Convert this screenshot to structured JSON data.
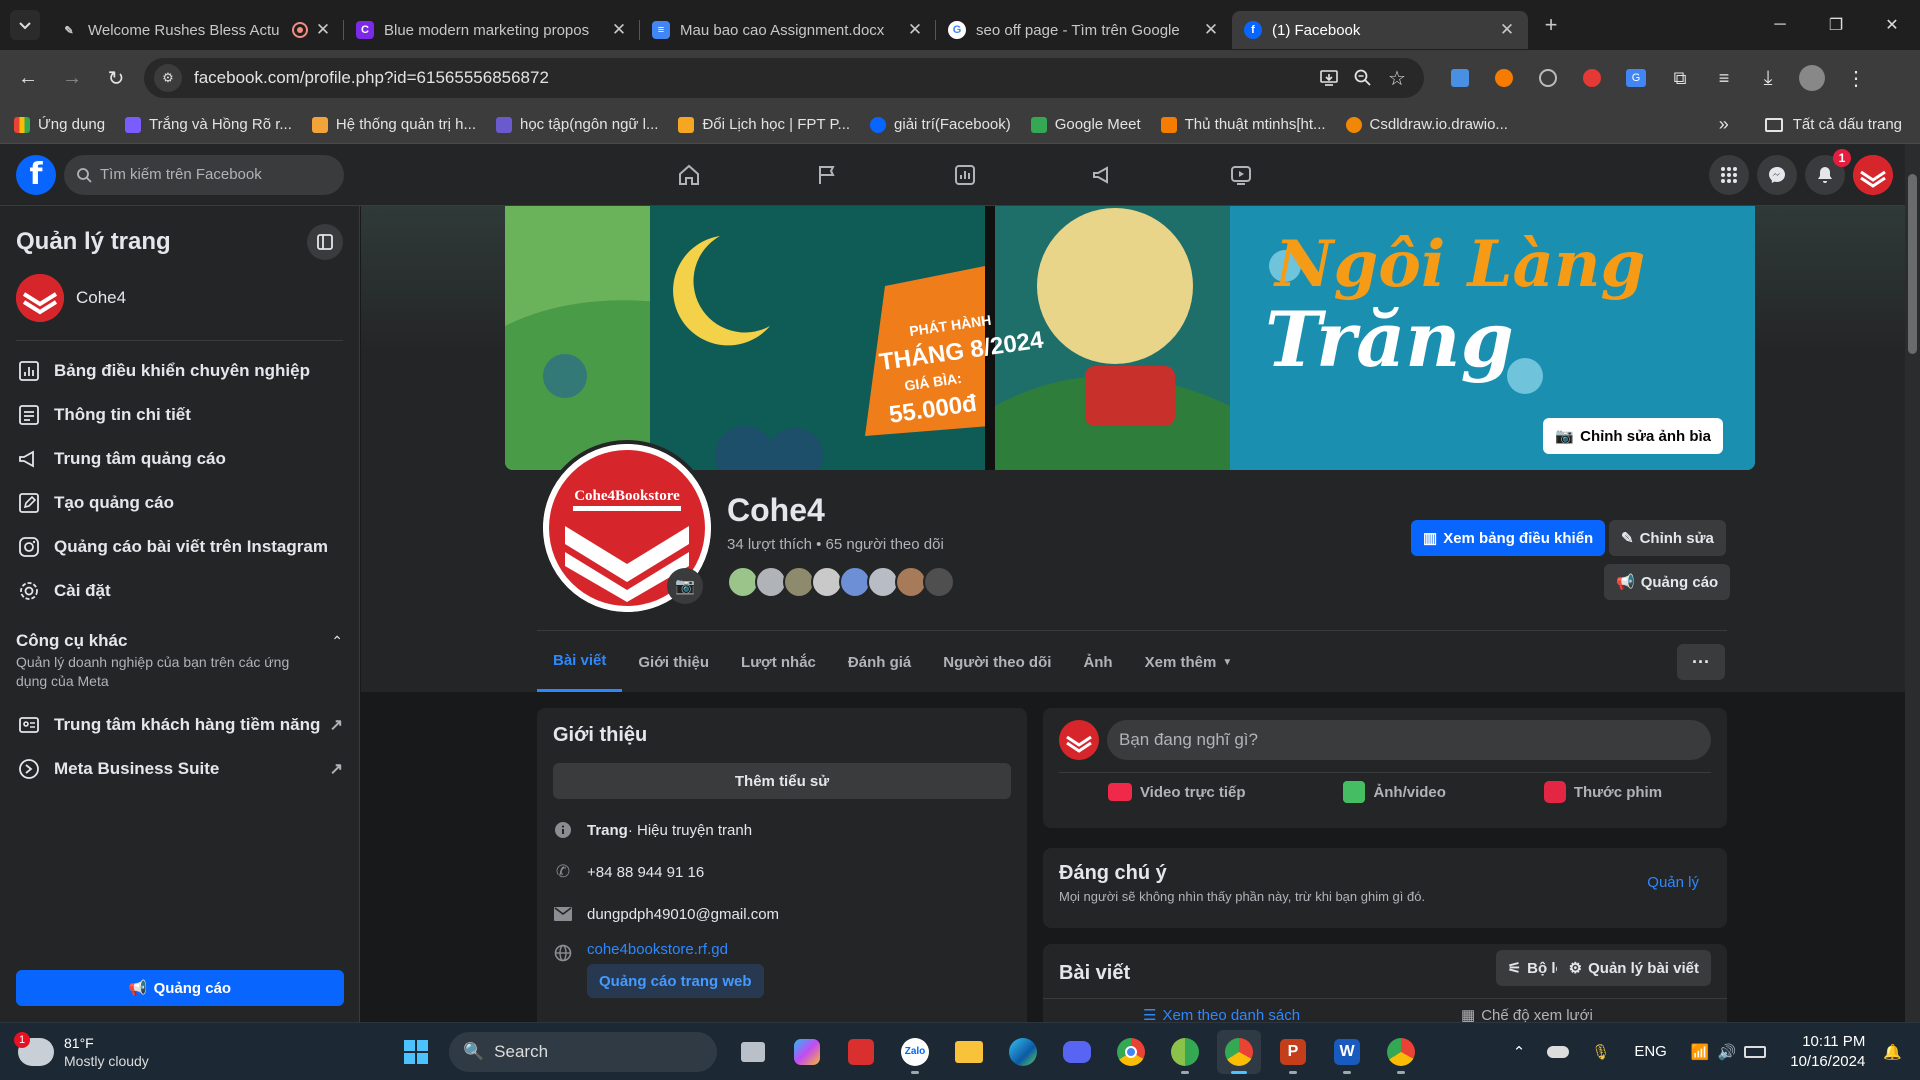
{
  "browser": {
    "tabs": [
      {
        "title": "Welcome Rushes Bless Actu",
        "icon": "feather-icon",
        "active": false
      },
      {
        "title": "Blue modern marketing propos",
        "icon": "canva-icon",
        "active": false
      },
      {
        "title": "Mau bao cao Assignment.docx",
        "icon": "docs-icon",
        "active": false
      },
      {
        "title": "seo off page - Tìm trên Google",
        "icon": "google-icon",
        "active": false
      },
      {
        "title": "(1) Facebook",
        "icon": "facebook-icon",
        "active": true
      }
    ],
    "url": "facebook.com/profile.php?id=61565556856872",
    "bookmarks": [
      {
        "label": "Ứng dụng",
        "color": "#e8a33d"
      },
      {
        "label": "Trắng và Hồng Rõ r...",
        "color": "#7b5cff"
      },
      {
        "label": "Hệ thống quản trị h...",
        "color": "#f2a43a"
      },
      {
        "label": "học tập(ngôn ngữ l...",
        "color": "#6a5acd"
      },
      {
        "label": "Đổi Lịch học | FPT P...",
        "color": "#f5a623"
      },
      {
        "label": "giải trí(Facebook)",
        "color": "#0866ff"
      },
      {
        "label": "Google Meet",
        "color": "#34a853"
      },
      {
        "label": "Thủ thuật mtinhs[ht...",
        "color": "#f57c00"
      },
      {
        "label": "Csdldraw.io.drawio...",
        "color": "#f08705"
      }
    ],
    "bookmarks_all": "Tất cả dấu trang"
  },
  "facebook": {
    "search_placeholder": "Tìm kiếm trên Facebook",
    "notifications_count": "1"
  },
  "sidebar": {
    "title": "Quản lý trang",
    "page_name": "Cohe4",
    "items": [
      {
        "label": "Bảng điều khiển chuyên nghiệp",
        "icon": "dashboard-icon"
      },
      {
        "label": "Thông tin chi tiết",
        "icon": "insights-icon"
      },
      {
        "label": "Trung tâm quảng cáo",
        "icon": "megaphone-icon"
      },
      {
        "label": "Tạo quảng cáo",
        "icon": "pencil-icon"
      },
      {
        "label": "Quảng cáo bài viết trên Instagram",
        "icon": "instagram-icon"
      },
      {
        "label": "Cài đặt",
        "icon": "gear-icon"
      }
    ],
    "other_tools_title": "Công cụ khác",
    "other_tools_desc": "Quản lý doanh nghiệp của bạn trên các ứng dụng của Meta",
    "tools": [
      {
        "label": "Trung tâm khách hàng tiềm năng",
        "icon": "leads-icon"
      },
      {
        "label": "Meta Business Suite",
        "icon": "meta-icon"
      }
    ],
    "ads_button": "Quảng cáo"
  },
  "profile": {
    "cover_texts": {
      "release": "PHÁT HÀNH",
      "month": "THÁNG 8/2024",
      "price_label": "GIÁ BÌA:",
      "price": "55.000đ",
      "title_line1": "Ngôi Làng",
      "title_line2": "Trăng"
    },
    "edit_cover": "Chỉnh sửa ảnh bìa",
    "avatar_text": "Cohe4Bookstore",
    "name": "Cohe4",
    "stats": "34 lượt thích • 65 người theo dõi",
    "btn_dashboard": "Xem bảng điều khiển",
    "btn_edit": "Chỉnh sửa",
    "btn_ads": "Quảng cáo",
    "tabs": [
      "Bài viết",
      "Giới thiệu",
      "Lượt nhắc",
      "Đánh giá",
      "Người theo dõi",
      "Ảnh",
      "Xem thêm"
    ],
    "more_dots": "···"
  },
  "intro": {
    "title": "Giới thiệu",
    "add_bio": "Thêm tiểu sử",
    "category_bold": "Trang",
    "category": " · Hiệu truyện tranh",
    "phone": "+84 88 944 91 16",
    "email": "dungpdph49010@gmail.com",
    "website": "cohe4bookstore.rf.gd",
    "promote_web": "Quảng cáo trang web"
  },
  "composer": {
    "placeholder": "Bạn đang nghĩ gì?",
    "live": "Video trực tiếp",
    "photo": "Ảnh/video",
    "reel": "Thước phim"
  },
  "featured": {
    "title": "Đáng chú ý",
    "desc": "Mọi người sẽ không nhìn thấy phần này, trừ khi bạn ghim gì đó.",
    "manage": "Quản lý"
  },
  "posts": {
    "title": "Bài viết",
    "filter": "Bộ lọc",
    "manage": "Quản lý bài viết",
    "list_view": "Xem theo danh sách",
    "grid_view": "Chế độ xem lưới"
  },
  "taskbar": {
    "weather_temp": "81°F",
    "weather_desc": "Mostly cloudy",
    "weather_badge": "1",
    "search": "Search",
    "lang": "ENG",
    "time": "10:11 PM",
    "date": "10/16/2024"
  }
}
